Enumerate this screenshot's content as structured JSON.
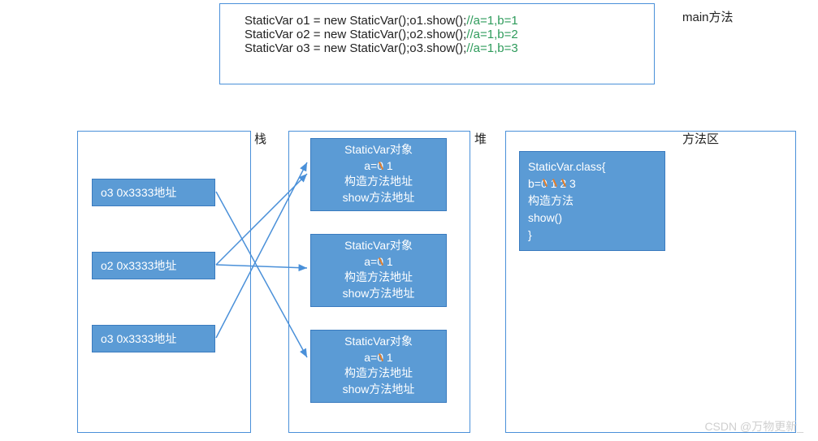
{
  "mainLabel": "main方法",
  "code": {
    "lines": [
      {
        "text": "StaticVar o1 = new StaticVar();o1.show();",
        "comment": "//a=1,b=1"
      },
      {
        "text": "StaticVar o2 = new StaticVar();o2.show();",
        "comment": "//a=1,b=2"
      },
      {
        "text": "StaticVar o3 = new StaticVar();o3.show();",
        "comment": "//a=1,b=3"
      }
    ]
  },
  "regions": {
    "stackLabel": "栈",
    "heapLabel": "堆",
    "methodAreaLabel": "方法区"
  },
  "stack": {
    "items": [
      {
        "label": "o3  0x3333地址"
      },
      {
        "label": "o2  0x3333地址"
      },
      {
        "label": "o3  0x3333地址"
      }
    ]
  },
  "heap": {
    "objTitle": "StaticVar对象",
    "aPrefix": "a=",
    "aStruck": "0",
    "aFinal": " 1",
    "ctorAddr": "构造方法地址",
    "showAddr": "show方法地址"
  },
  "methodArea": {
    "classHeader": "StaticVar.class{",
    "bPrefix": "b=",
    "bStruck1": "0",
    "bStruck2": "1",
    "bStruck3": "2",
    "bFinal": " 3",
    "ctor": "构造方法",
    "show": "show()",
    "close": "}"
  },
  "watermark": "CSDN @万物更新_"
}
